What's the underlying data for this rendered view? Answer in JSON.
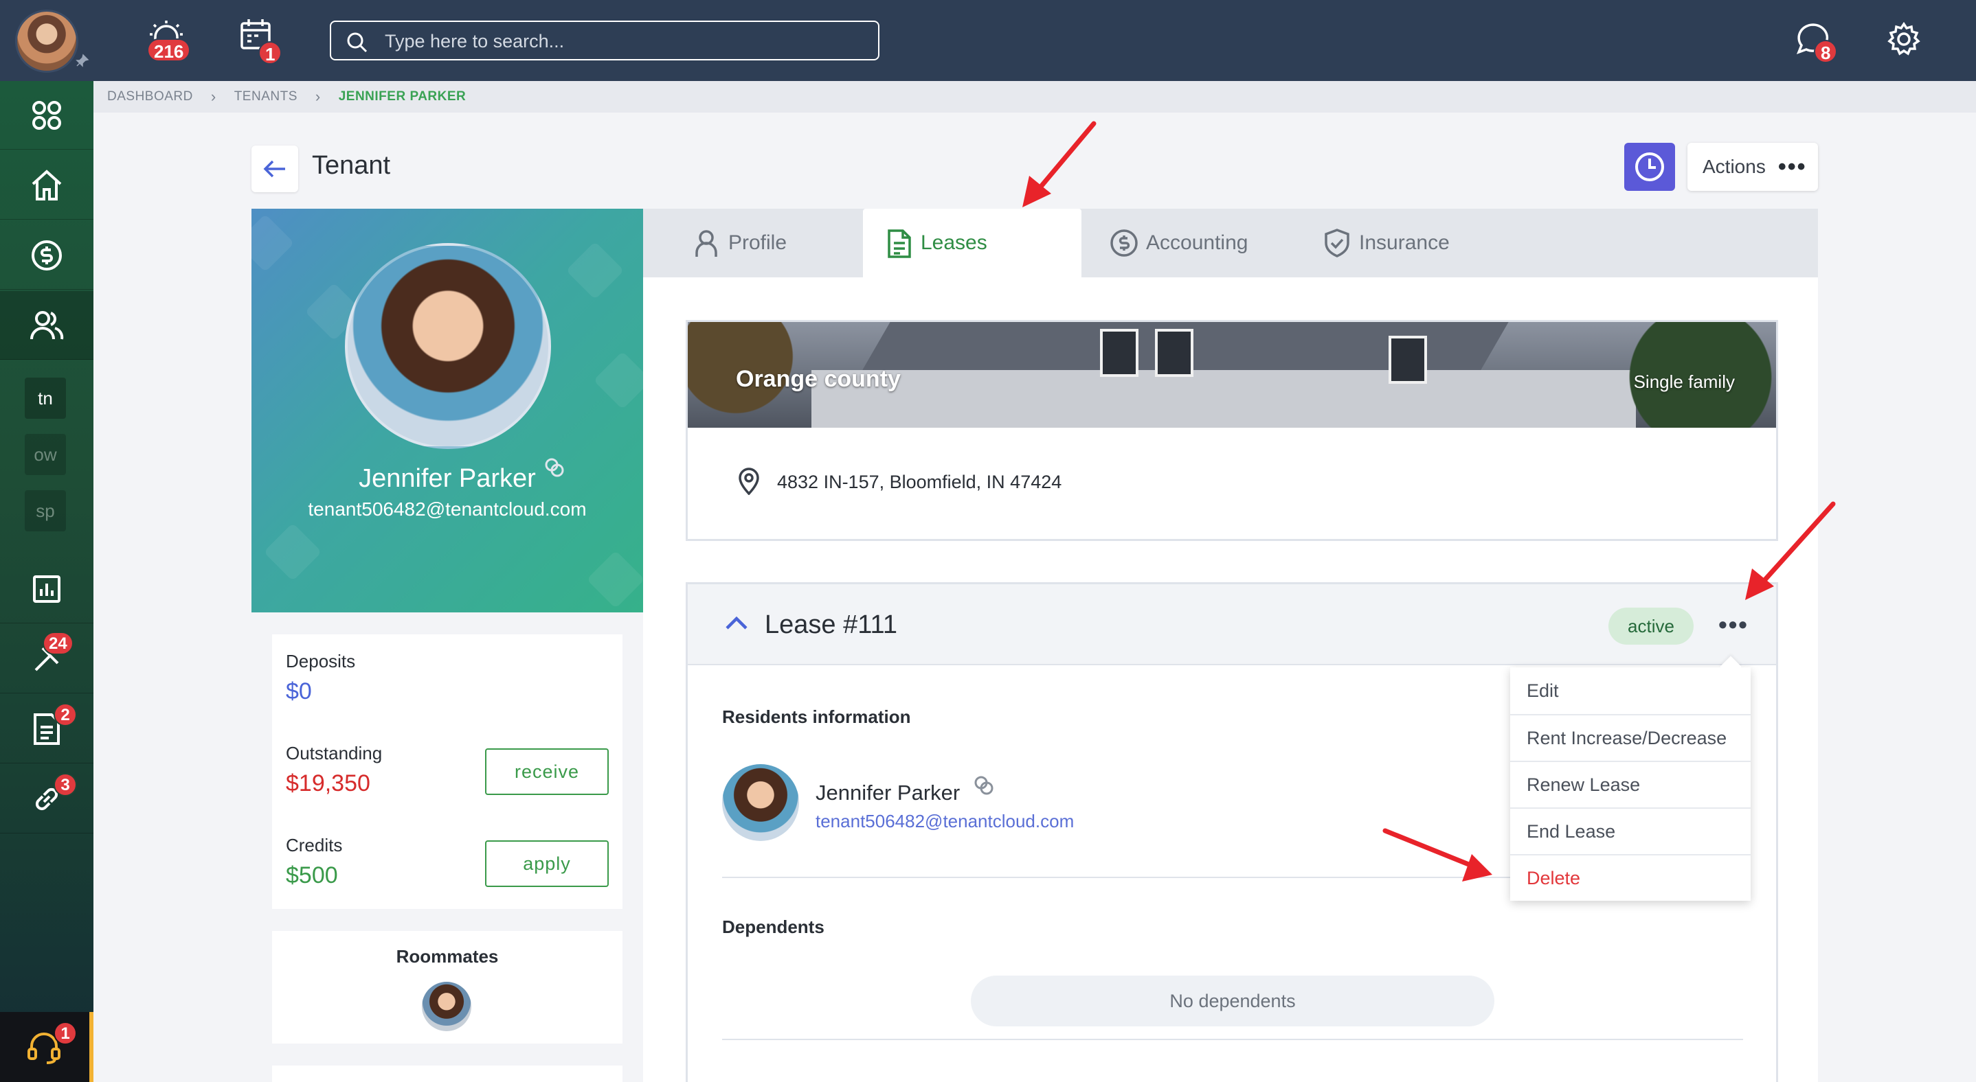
{
  "topbar": {
    "notifications_count": "216",
    "calendar_count": "1",
    "messages_count": "8",
    "search_placeholder": "Type here to search..."
  },
  "sidebar": {
    "items": [
      {
        "icon": "grid-icon"
      },
      {
        "icon": "home-icon"
      },
      {
        "icon": "dollar-icon"
      },
      {
        "icon": "users-icon",
        "active": true
      },
      {
        "label": "tn"
      },
      {
        "label": "ow"
      },
      {
        "label": "sp"
      },
      {
        "icon": "reports-icon"
      },
      {
        "icon": "maintenance-icon",
        "badge": "24"
      },
      {
        "icon": "documents-icon",
        "badge": "2"
      },
      {
        "icon": "link-icon",
        "badge": "3"
      }
    ],
    "support_badge": "1"
  },
  "breadcrumb": [
    "DASHBOARD",
    "TENANTS",
    "JENNIFER PARKER"
  ],
  "header": {
    "title": "Tenant",
    "actions_label": "Actions"
  },
  "profile": {
    "name": "Jennifer Parker",
    "email": "tenant506482@tenantcloud.com"
  },
  "balances": {
    "deposits_label": "Deposits",
    "deposits_value": "$0",
    "outstanding_label": "Outstanding",
    "outstanding_value": "$19,350",
    "receive_label": "receive",
    "credits_label": "Credits",
    "credits_value": "$500",
    "apply_label": "apply"
  },
  "roommates": {
    "title": "Roommates"
  },
  "tabs": [
    {
      "label": "Profile",
      "icon": "user-icon"
    },
    {
      "label": "Leases",
      "icon": "document-icon",
      "active": true
    },
    {
      "label": "Accounting",
      "icon": "dollar-circle-icon"
    },
    {
      "label": "Insurance",
      "icon": "shield-icon"
    }
  ],
  "property": {
    "name": "Orange county",
    "type": "Single family",
    "address": "4832 IN-157, Bloomfield, IN 47424"
  },
  "lease": {
    "title": "Lease #111",
    "status": "active",
    "residents_title": "Residents information",
    "resident_name": "Jennifer Parker",
    "resident_email": "tenant506482@tenantcloud.com",
    "dependents_title": "Dependents",
    "no_dependents": "No dependents"
  },
  "lease_menu": [
    "Edit",
    "Rent Increase/Decrease",
    "Renew Lease",
    "End Lease",
    "Delete"
  ],
  "colors": {
    "topbar": "#2e3e55",
    "accent_green": "#3a9a4a",
    "danger": "#e2373b",
    "link_blue": "#5a6fd6",
    "annotation_arrow": "#e8232a"
  }
}
